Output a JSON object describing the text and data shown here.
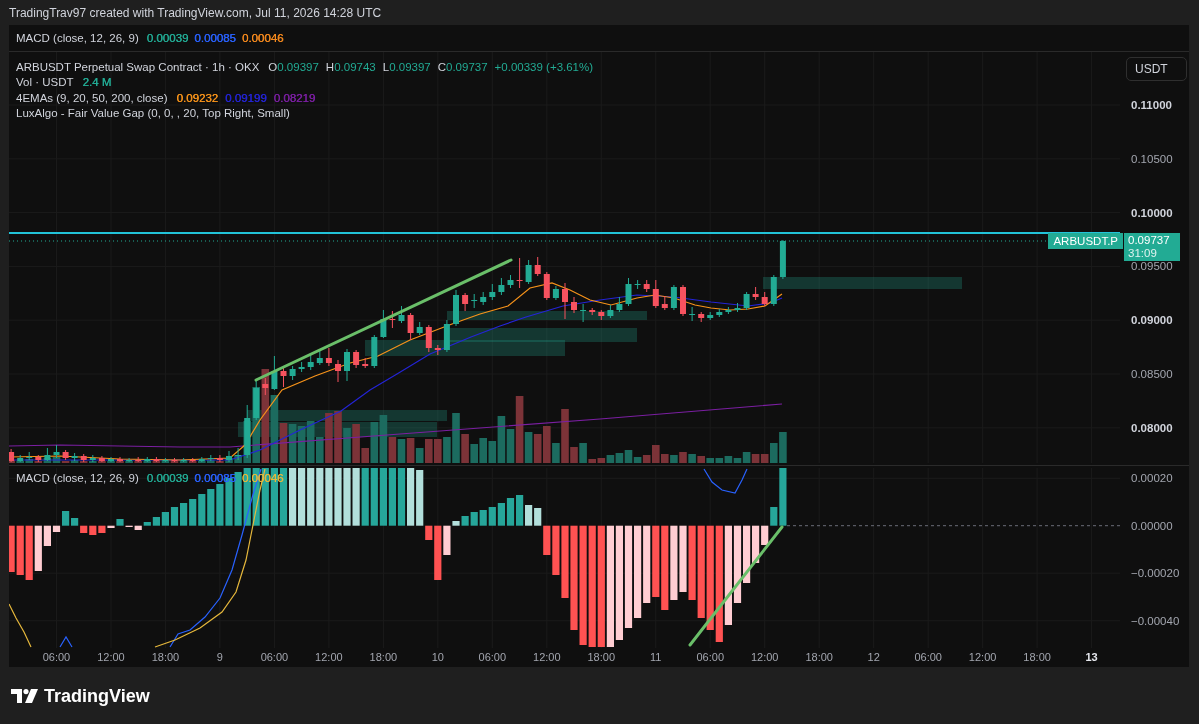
{
  "header": {
    "attribution": "TradingTrav97 created with TradingView.com, Jul 11, 2026 14:28 UTC"
  },
  "collapsed_pane": {
    "title": "MACD (close, 12, 26, 9)",
    "values": [
      {
        "text": "0.00039",
        "color": "#22ab94"
      },
      {
        "text": "0.00085",
        "color": "#2962ff"
      },
      {
        "text": "0.00046",
        "color": "#f68a1e"
      }
    ]
  },
  "main_pane": {
    "symbol": {
      "title": "ARBUSDT Perpetual Swap Contract · 1h · OKX",
      "ohlc": [
        {
          "label": "O",
          "value": "0.09397"
        },
        {
          "label": "H",
          "value": "0.09743"
        },
        {
          "label": "L",
          "value": "0.09397"
        },
        {
          "label": "C",
          "value": "0.09737"
        }
      ],
      "change": "+0.00339 (+3.61%)"
    },
    "indicators": [
      {
        "title": "Vol · USDT",
        "values": [
          {
            "text": "2.4 M",
            "color": "#22ab94"
          }
        ]
      },
      {
        "title": "4EMAs (9, 20, 50, 200, close)",
        "values": [
          {
            "text": "0.09232",
            "color": "#f7931a"
          },
          {
            "text": "0.09199",
            "color": "#2424d6"
          },
          {
            "text": "0.08219",
            "color": "#7b1fa2"
          }
        ]
      },
      {
        "title": "LuxAlgo - Fair Value Gap (0, 0, , 20, Top Right, Small)"
      }
    ],
    "currency_button": "USDT",
    "price_scale": [
      {
        "label": "0.11000",
        "emphasized": true
      },
      {
        "label": "0.10500",
        "emphasized": false
      },
      {
        "label": "0.10000",
        "emphasized": true
      },
      {
        "label": "0.09500",
        "emphasized": false
      },
      {
        "label": "0.09000",
        "emphasized": true
      },
      {
        "label": "0.08500",
        "emphasized": false
      },
      {
        "label": "0.08000",
        "emphasized": true
      }
    ],
    "symbol_tag": "ARBUSDT.P",
    "last_price": {
      "price": "0.09737",
      "countdown": "31:09"
    }
  },
  "macd_pane": {
    "title": "MACD (close, 12, 26, 9)",
    "values": [
      {
        "text": "0.00039",
        "color": "#22ab94"
      },
      {
        "text": "0.00085",
        "color": "#2962ff"
      },
      {
        "text": "0.00046",
        "color": "#e6b83c"
      }
    ],
    "scale": [
      "0.00020",
      "0.00000",
      "−0.00020",
      "−0.00040"
    ]
  },
  "time_scale": [
    {
      "label": "06:00",
      "emphasized": false
    },
    {
      "label": "12:00",
      "emphasized": false
    },
    {
      "label": "18:00",
      "emphasized": false
    },
    {
      "label": "9",
      "emphasized": false
    },
    {
      "label": "06:00",
      "emphasized": false
    },
    {
      "label": "12:00",
      "emphasized": false
    },
    {
      "label": "18:00",
      "emphasized": false
    },
    {
      "label": "10",
      "emphasized": false
    },
    {
      "label": "06:00",
      "emphasized": false
    },
    {
      "label": "12:00",
      "emphasized": false
    },
    {
      "label": "18:00",
      "emphasized": false
    },
    {
      "label": "11",
      "emphasized": false
    },
    {
      "label": "06:00",
      "emphasized": false
    },
    {
      "label": "12:00",
      "emphasized": false
    },
    {
      "label": "18:00",
      "emphasized": false
    },
    {
      "label": "12",
      "emphasized": false
    },
    {
      "label": "06:00",
      "emphasized": false
    },
    {
      "label": "12:00",
      "emphasized": false
    },
    {
      "label": "18:00",
      "emphasized": false
    },
    {
      "label": "13",
      "emphasized": true
    }
  ],
  "footer": {
    "brand": "TradingView"
  }
}
